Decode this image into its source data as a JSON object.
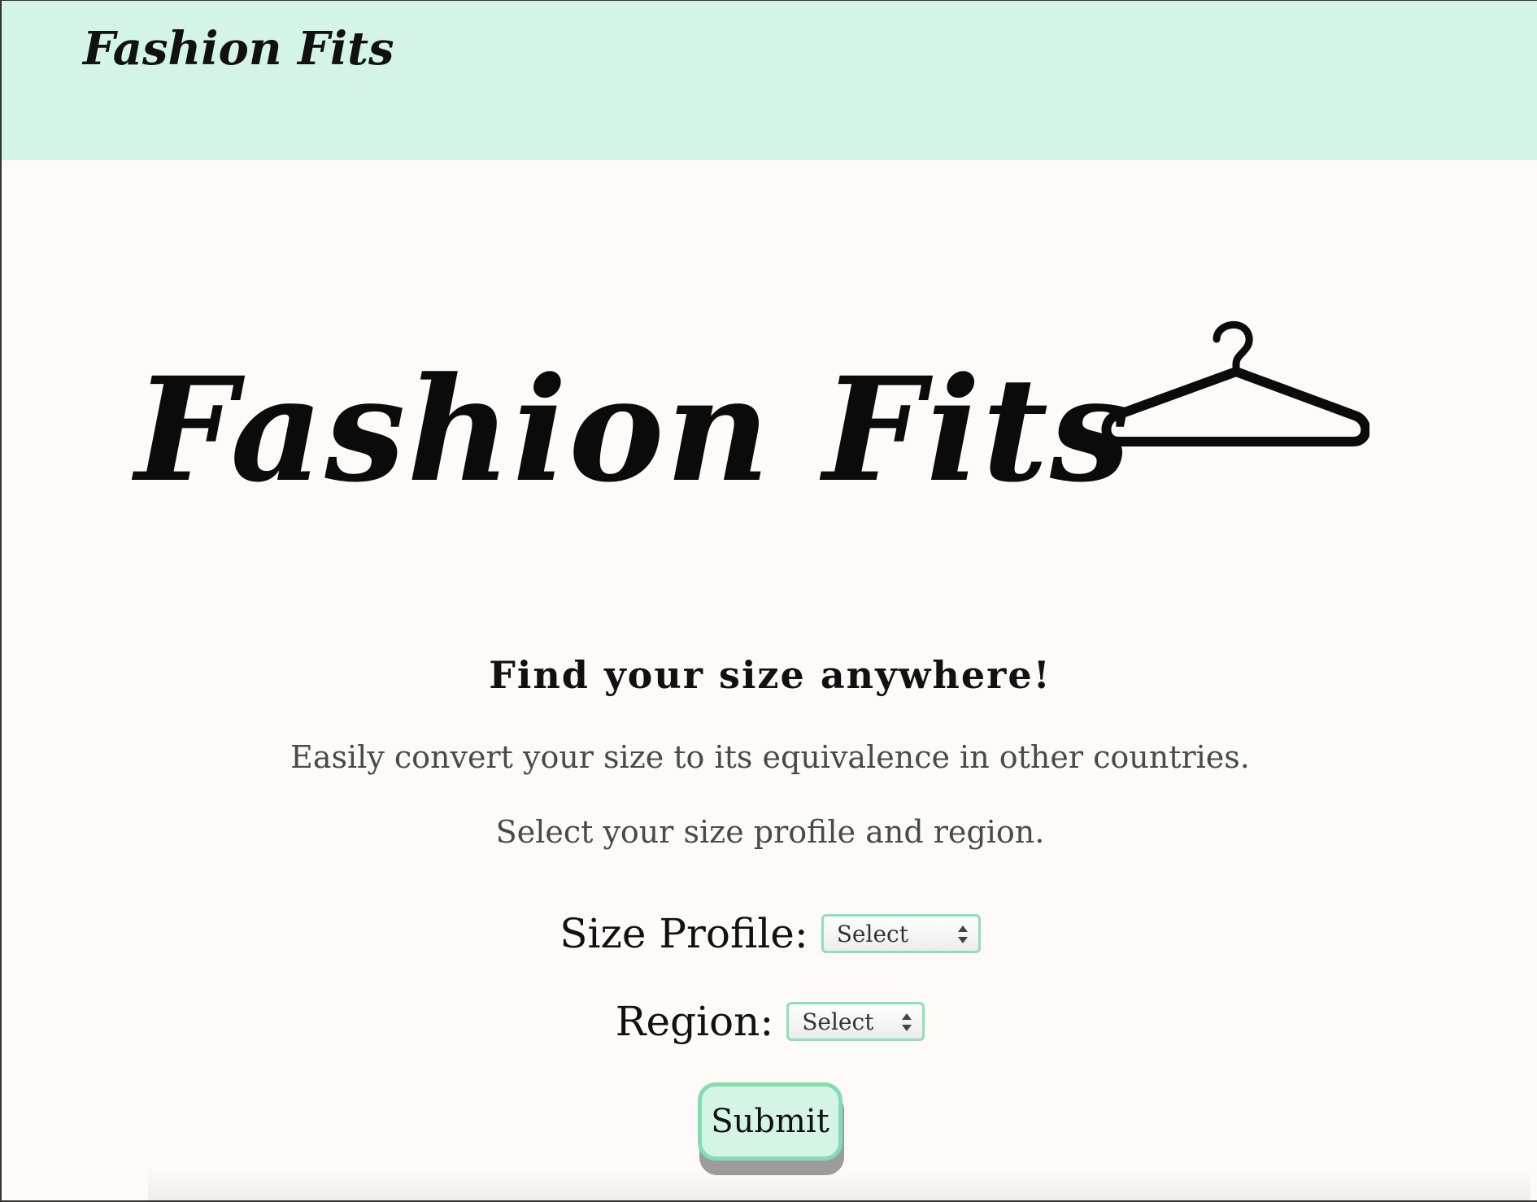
{
  "navbar": {
    "brand": "Fashion Fits",
    "background_color": "#d4f5e5"
  },
  "hero": {
    "title": "Fashion Fits",
    "icon": "hanger-icon"
  },
  "intro": {
    "tagline": "Find your size anywhere!",
    "description_1": "Easily convert your size to its equivalence in other countries.",
    "description_2": "Select your size profile and region."
  },
  "form": {
    "size_profile": {
      "label": "Size Profile:",
      "selected": "Select"
    },
    "region": {
      "label": "Region:",
      "selected": "Select"
    },
    "submit_label": "Submit",
    "accent_color": "#84dcb2"
  }
}
